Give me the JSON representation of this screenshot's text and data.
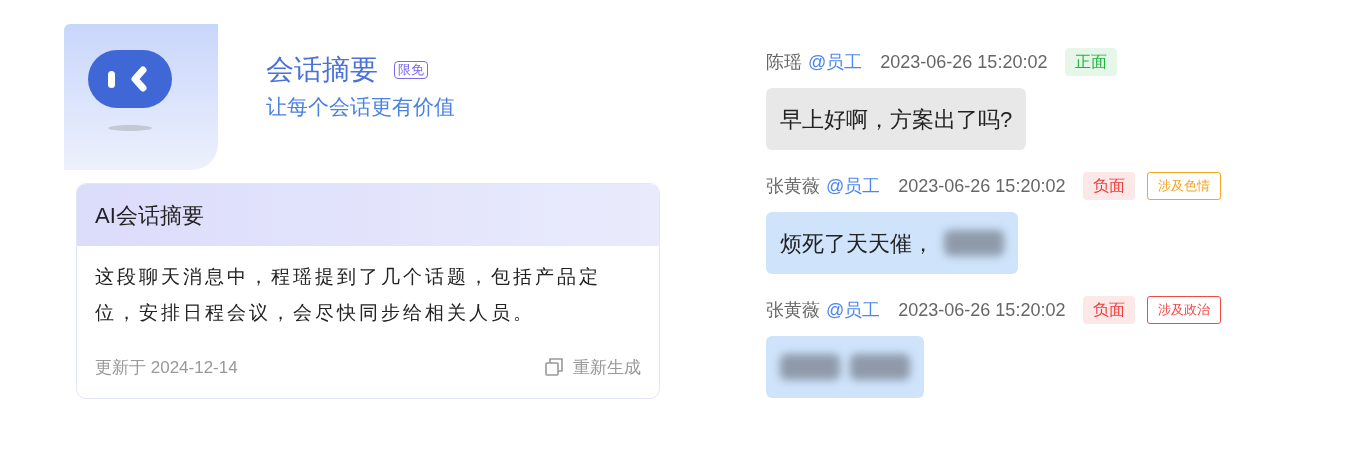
{
  "header": {
    "title": "会话摘要",
    "badge": "限免",
    "subtitle": "让每个会话更有价值"
  },
  "summary": {
    "title": "AI会话摘要",
    "body": "这段聊天消息中，程瑶提到了几个话题，包括产品定位，安排日程会议，会尽快同步给相关人员。",
    "updated": "更新于 2024-12-14",
    "action": "重新生成"
  },
  "messages": [
    {
      "sender": "陈瑶",
      "role": "@员工",
      "time": "2023-06-26 15:20:02",
      "sentiment": {
        "label": "正面",
        "kind": "positive"
      },
      "segments": [
        {
          "kind": "text",
          "text": "早上好啊，方案出了吗?"
        }
      ]
    },
    {
      "sender": "张黄薇",
      "role": "@员工",
      "time": "2023-06-26 15:20:02",
      "sentiment": {
        "label": "负面",
        "kind": "negative"
      },
      "flags": [
        {
          "label": "涉及色情",
          "color": "#f5a524"
        }
      ],
      "segments": [
        {
          "kind": "text",
          "text": "烦死了天天催，"
        },
        {
          "kind": "blurred"
        }
      ]
    },
    {
      "sender": "张黄薇",
      "role": "@员工",
      "time": "2023-06-26 15:20:02",
      "sentiment": {
        "label": "负面",
        "kind": "negative"
      },
      "flags": [
        {
          "label": "涉及政治",
          "color": "#f04848"
        }
      ],
      "segments": [
        {
          "kind": "blurred"
        },
        {
          "kind": "blurred"
        }
      ]
    }
  ]
}
